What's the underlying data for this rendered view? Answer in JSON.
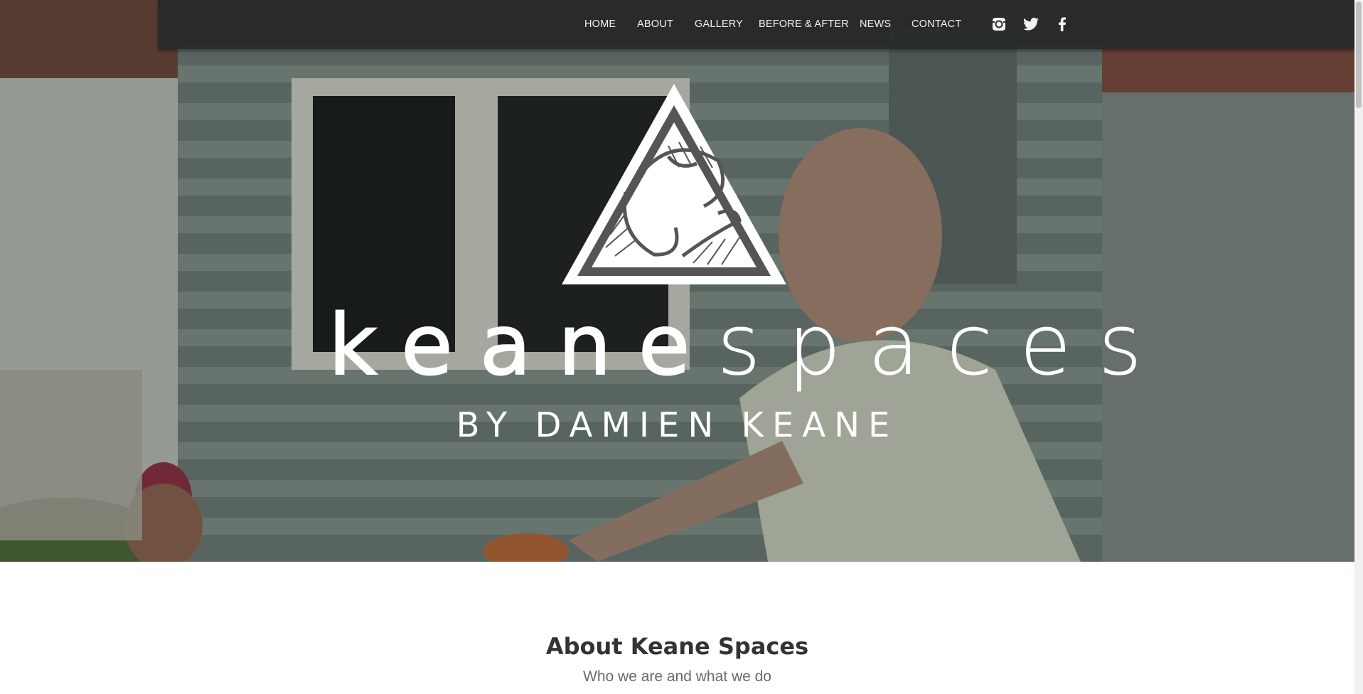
{
  "nav": {
    "items": [
      {
        "label": "HOME"
      },
      {
        "label": "ABOUT"
      },
      {
        "label": "GALLERY"
      },
      {
        "label": "BEFORE & AFTER"
      },
      {
        "label": "NEWS"
      },
      {
        "label": "CONTACT"
      }
    ],
    "social": [
      "instagram-icon",
      "twitter-icon",
      "facebook-icon"
    ]
  },
  "hero": {
    "brand_bold": "keane",
    "brand_light": "spaces",
    "tagline": "BY DAMIEN KEANE"
  },
  "about": {
    "title": "About Keane Spaces",
    "subtitle": "Who we are and what we do"
  },
  "colors": {
    "navbar": "#262a28",
    "nav_text": "#f2f2f2",
    "about_title": "#333333",
    "about_subtitle": "#6a6a6a"
  }
}
